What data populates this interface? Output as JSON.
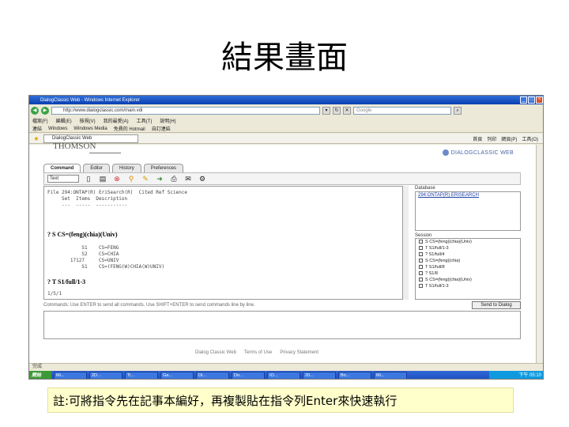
{
  "slide": {
    "title": "結果畫面",
    "note": "註:可將指令先在記事本編好，再複製貼在指令列Enter來快速執行"
  },
  "browser": {
    "title": "DialogClassic Web - Windows Internet Explorer",
    "address": "http://www.dialogclassic.com/main.vdi",
    "search_placeholder": "Google",
    "menu": [
      "檔案(F)",
      "編輯(E)",
      "檢視(V)",
      "我的最愛(A)",
      "工具(T)",
      "說明(H)"
    ],
    "links": [
      "連結",
      "Windows",
      "Windows Media",
      "免費的 Hotmail",
      "自訂連結"
    ],
    "tab_label": "DialogClassic Web",
    "toolbar_right": [
      "首頁",
      "列印",
      "網頁(P)",
      "工具(O)"
    ],
    "status": "完成"
  },
  "app": {
    "brand": "DIALOGCLASSIC WEB",
    "tabs": [
      "Command",
      "Editor",
      "History",
      "Preferences"
    ],
    "format": "Text",
    "command_lines": [
      "File 294:ONTAP(R) EriSearch(R)  Cited Ref Science",
      "     Set  Items  Description",
      "     ---  -----  -----------",
      "? S CS=(feng)(chia)(Univ)",
      "            S1    CS=FENG",
      "            S2    CS=CHIA",
      "        17127     CS=UNIV",
      "            S1    CS=(FENG(W)CHIA(W)UNIV)",
      "? T S1/full/1-3",
      "1/5/1"
    ],
    "database_label": "Database",
    "database_value": "294:ONTAP(R) ERISEARCH",
    "session_label": "Session",
    "session_items": [
      "S CS=(feng)(chia)(Univ)",
      "T S1/full/1-3",
      "? S1/full/4",
      "S CS=(feng)(chia)",
      "T S1/full/8",
      "? S1/8",
      "S CS=(feng)(chia)(Univ)",
      "T S1/full/1-3"
    ],
    "command_hint": "Commands: Use ENTER to send all commands. Use SHIFT+ENTER to send commands line by line.",
    "send_button": "Send to Dialog",
    "footer_links": [
      "Dialog Classic Web",
      "Terms of Use",
      "Privacy Statement"
    ]
  },
  "taskbar": {
    "start": "開始",
    "items": [
      "Mi...",
      "2D...",
      "Ti...",
      "Ga...",
      "Di...",
      "Do...",
      "IO...",
      "20...",
      "Bo...",
      "Mi..."
    ],
    "clock": "下午 05:10"
  }
}
